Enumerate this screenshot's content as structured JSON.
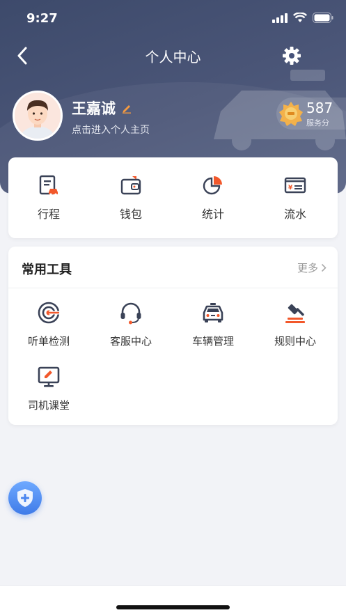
{
  "status": {
    "time": "9:27"
  },
  "nav": {
    "title": "个人中心"
  },
  "profile": {
    "name": "王嘉诚",
    "subtitle": "点击进入个人主页"
  },
  "score": {
    "value": "587",
    "label": "服务分"
  },
  "quick_actions": [
    {
      "label": "行程",
      "icon": "trip-doc-icon"
    },
    {
      "label": "钱包",
      "icon": "wallet-icon"
    },
    {
      "label": "统计",
      "icon": "pie-chart-icon"
    },
    {
      "label": "流水",
      "icon": "bill-icon"
    }
  ],
  "tools": {
    "title": "常用工具",
    "more": "更多",
    "items": [
      {
        "label": "听单检测",
        "icon": "target-icon"
      },
      {
        "label": "客服中心",
        "icon": "headset-icon"
      },
      {
        "label": "车辆管理",
        "icon": "car-icon"
      },
      {
        "label": "规则中心",
        "icon": "gavel-icon"
      },
      {
        "label": "司机课堂",
        "icon": "classroom-icon"
      }
    ]
  },
  "colors": {
    "accent": "#f2582b",
    "icon_dark": "#3a4257",
    "header": "#3d4a6b",
    "fab": "#4a86f0"
  }
}
